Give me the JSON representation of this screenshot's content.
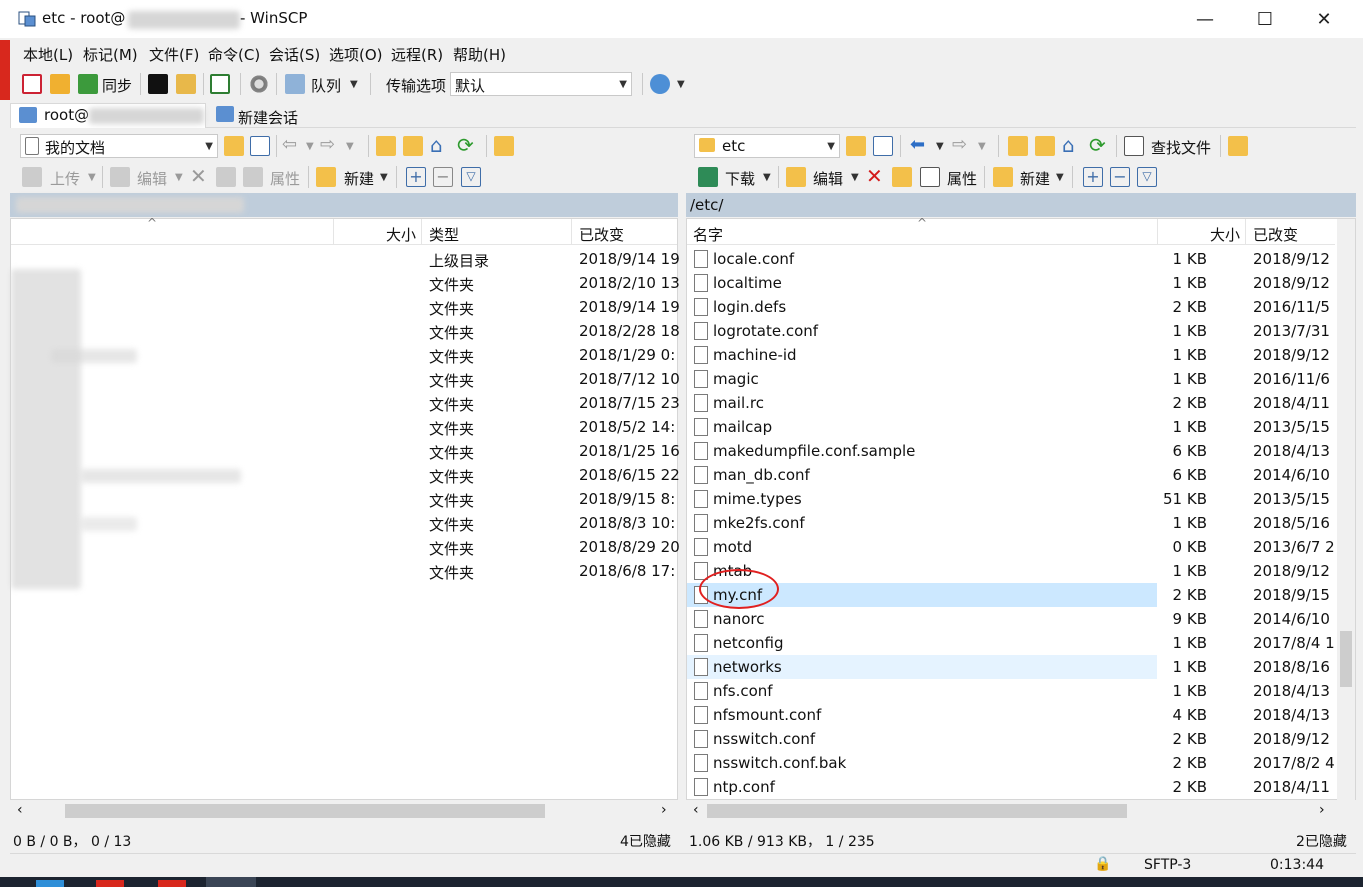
{
  "window": {
    "title_prefix": "etc - root@",
    "title_suffix": " - WinSCP",
    "minimize": "—",
    "maximize": "☐",
    "close": "✕"
  },
  "menu": [
    "本地(L)",
    "标记(M)",
    "文件(F)",
    "命令(C)",
    "会话(S)",
    "选项(O)",
    "远程(R)",
    "帮助(H)"
  ],
  "toolbar": {
    "sync": "同步",
    "queue": "队列",
    "transfer_options_label": "传输选项",
    "transfer_preset": "默认"
  },
  "tabs": {
    "session": "root@",
    "new_session": "新建会话"
  },
  "left": {
    "location": "我的文档",
    "actions": {
      "upload": "上传",
      "edit": "编辑",
      "properties": "属性",
      "new": "新建"
    },
    "headers": {
      "size": "大小",
      "type": "类型",
      "changed": "已改变"
    },
    "rows": [
      {
        "type": "上级目录",
        "changed": "2018/9/14 19"
      },
      {
        "type": "文件夹",
        "changed": "2018/2/10 13"
      },
      {
        "type": "文件夹",
        "changed": "2018/9/14 19"
      },
      {
        "type": "文件夹",
        "changed": "2018/2/28 18"
      },
      {
        "type": "文件夹",
        "changed": "2018/1/29 0:"
      },
      {
        "type": "文件夹",
        "changed": "2018/7/12 10"
      },
      {
        "type": "文件夹",
        "changed": "2018/7/15 23"
      },
      {
        "type": "文件夹",
        "changed": "2018/5/2 14:"
      },
      {
        "type": "文件夹",
        "changed": "2018/1/25 16"
      },
      {
        "type": "文件夹",
        "changed": "2018/6/15 22"
      },
      {
        "type": "文件夹",
        "changed": "2018/9/15 8:"
      },
      {
        "type": "文件夹",
        "changed": "2018/8/3 10:"
      },
      {
        "type": "文件夹",
        "changed": "2018/8/29 20"
      },
      {
        "type": "文件夹",
        "changed": "2018/6/8 17:"
      }
    ],
    "status_left": "0 B / 0 B，  0 / 13",
    "status_right": "4已隐藏"
  },
  "right": {
    "location": "etc",
    "find_files": "查找文件",
    "actions": {
      "download": "下载",
      "edit": "编辑",
      "properties": "属性",
      "new": "新建"
    },
    "path": "/etc/",
    "headers": {
      "name": "名字",
      "size": "大小",
      "changed": "已改变"
    },
    "rows": [
      {
        "name": "locale.conf",
        "size": "1 KB",
        "changed": "2018/9/12"
      },
      {
        "name": "localtime",
        "size": "1 KB",
        "changed": "2018/9/12"
      },
      {
        "name": "login.defs",
        "size": "2 KB",
        "changed": "2016/11/5"
      },
      {
        "name": "logrotate.conf",
        "size": "1 KB",
        "changed": "2013/7/31"
      },
      {
        "name": "machine-id",
        "size": "1 KB",
        "changed": "2018/9/12"
      },
      {
        "name": "magic",
        "size": "1 KB",
        "changed": "2016/11/6"
      },
      {
        "name": "mail.rc",
        "size": "2 KB",
        "changed": "2018/4/11"
      },
      {
        "name": "mailcap",
        "size": "1 KB",
        "changed": "2013/5/15"
      },
      {
        "name": "makedumpfile.conf.sample",
        "size": "6 KB",
        "changed": "2018/4/13"
      },
      {
        "name": "man_db.conf",
        "size": "6 KB",
        "changed": "2014/6/10"
      },
      {
        "name": "mime.types",
        "size": "51 KB",
        "changed": "2013/5/15"
      },
      {
        "name": "mke2fs.conf",
        "size": "1 KB",
        "changed": "2018/5/16"
      },
      {
        "name": "motd",
        "size": "0 KB",
        "changed": "2013/6/7 2"
      },
      {
        "name": "mtab",
        "size": "1 KB",
        "changed": "2018/9/12"
      },
      {
        "name": "my.cnf",
        "size": "2 KB",
        "changed": "2018/9/15"
      },
      {
        "name": "nanorc",
        "size": "9 KB",
        "changed": "2014/6/10"
      },
      {
        "name": "netconfig",
        "size": "1 KB",
        "changed": "2017/8/4 1"
      },
      {
        "name": "networks",
        "size": "1 KB",
        "changed": "2018/8/16"
      },
      {
        "name": "nfs.conf",
        "size": "1 KB",
        "changed": "2018/4/13"
      },
      {
        "name": "nfsmount.conf",
        "size": "4 KB",
        "changed": "2018/4/13"
      },
      {
        "name": "nsswitch.conf",
        "size": "2 KB",
        "changed": "2018/9/12"
      },
      {
        "name": "nsswitch.conf.bak",
        "size": "2 KB",
        "changed": "2017/8/2 4"
      },
      {
        "name": "ntp.conf",
        "size": "2 KB",
        "changed": "2018/4/11"
      }
    ],
    "status_left": "1.06 KB / 913 KB，  1 / 235",
    "status_right": "2已隐藏"
  },
  "statusbar": {
    "protocol": "SFTP-3",
    "time": "0:13:44"
  },
  "colors": {
    "accent": "#cce8ff",
    "path_bar": "#bfcddb",
    "highlight_ring": "#e02020"
  }
}
